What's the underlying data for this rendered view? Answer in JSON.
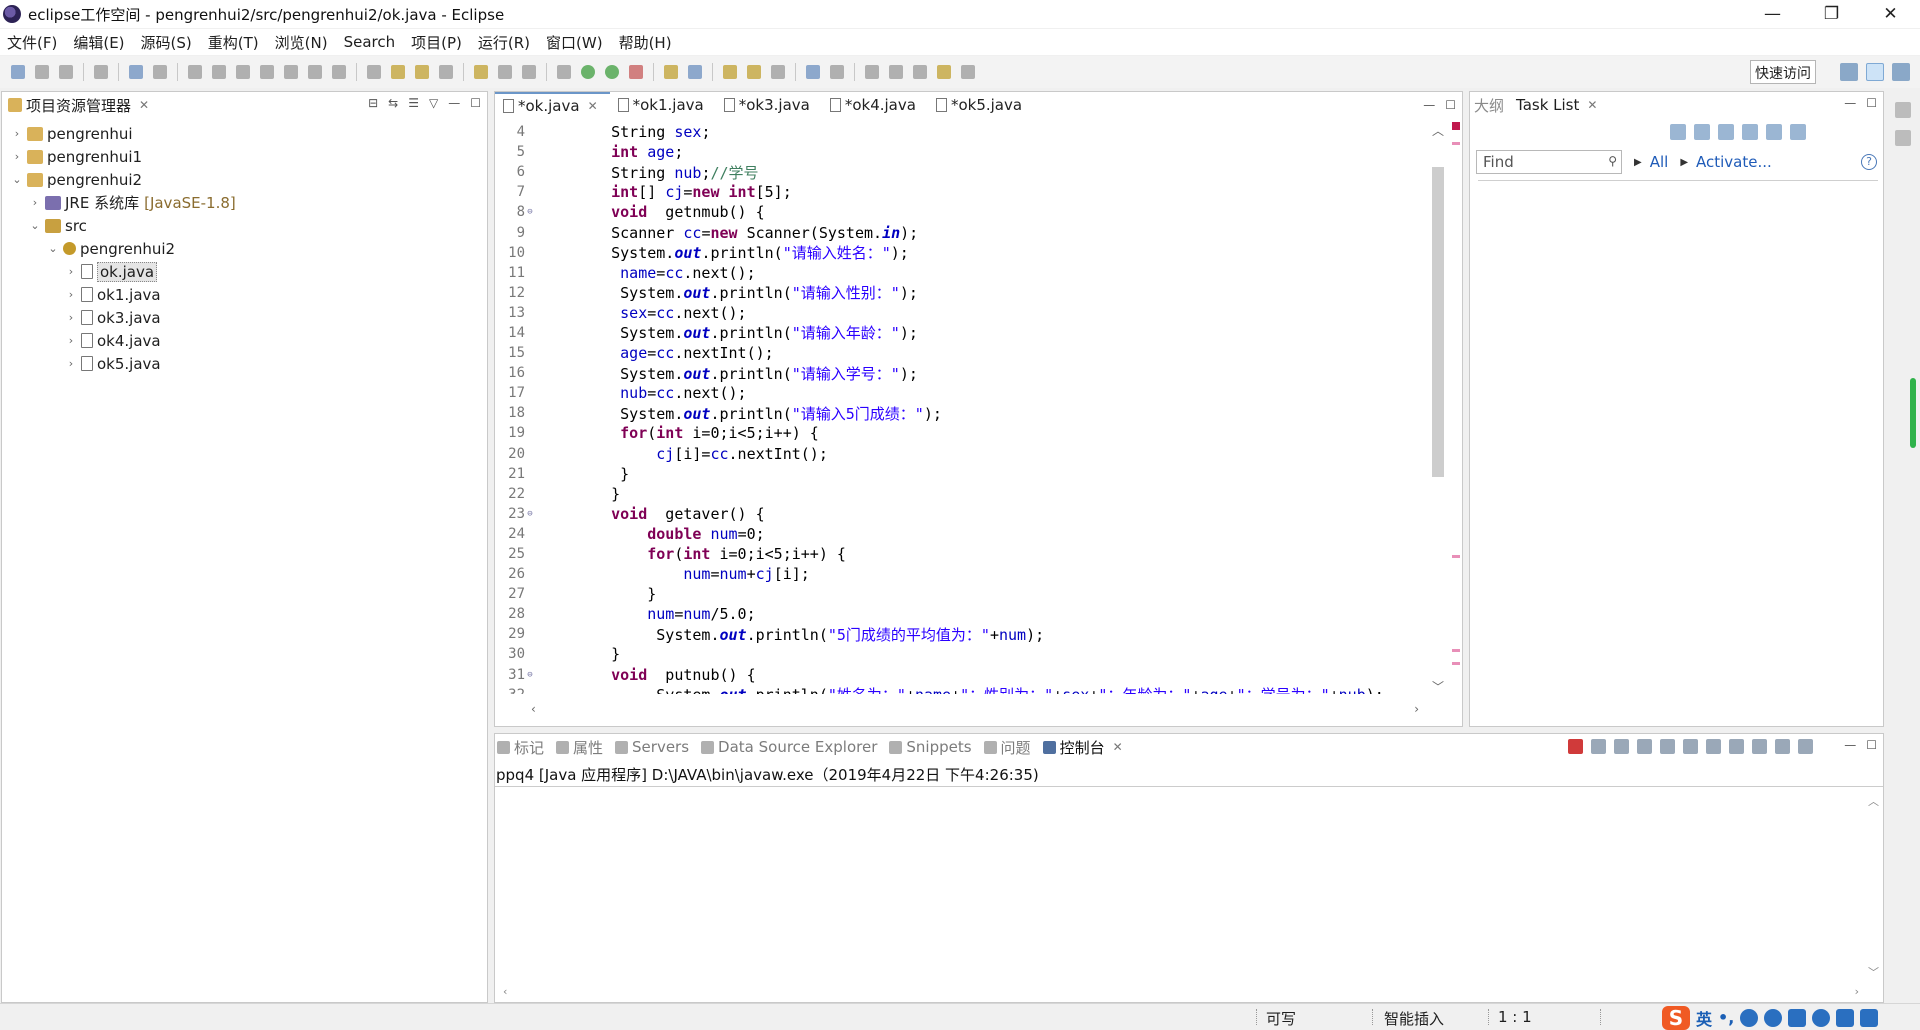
{
  "window": {
    "title": "eclipse工作空间 - pengrenhui2/src/pengrenhui2/ok.java - Eclipse"
  },
  "menu": [
    "文件(F)",
    "编辑(E)",
    "源码(S)",
    "重构(T)",
    "浏览(N)",
    "Search",
    "项目(P)",
    "运行(R)",
    "窗口(W)",
    "帮助(H)"
  ],
  "toolbar": {
    "quick_access": "快速访问"
  },
  "explorer": {
    "title": "项目资源管理器",
    "tree": [
      {
        "label": "pengrenhui",
        "twisty": "›",
        "icon": "project-icon",
        "indent": 0
      },
      {
        "label": "pengrenhui1",
        "twisty": "›",
        "icon": "project-icon",
        "indent": 0
      },
      {
        "label": "pengrenhui2",
        "twisty": "⌄",
        "icon": "project-icon",
        "indent": 0
      },
      {
        "label": "JRE 系统库",
        "extra": "[JavaSE-1.8]",
        "twisty": "›",
        "icon": "jre-library-icon",
        "indent": 1
      },
      {
        "label": "src",
        "twisty": "⌄",
        "icon": "source-folder-icon",
        "indent": 1
      },
      {
        "label": "pengrenhui2",
        "twisty": "⌄",
        "icon": "package-icon",
        "indent": 2
      },
      {
        "label": "ok.java",
        "twisty": "›",
        "icon": "java-file-icon",
        "indent": 3,
        "selected": true
      },
      {
        "label": "ok1.java",
        "twisty": "›",
        "icon": "java-file-icon",
        "indent": 3
      },
      {
        "label": "ok3.java",
        "twisty": "›",
        "icon": "java-file-icon",
        "indent": 3
      },
      {
        "label": "ok4.java",
        "twisty": "›",
        "icon": "java-file-icon",
        "indent": 3
      },
      {
        "label": "ok5.java",
        "twisty": "›",
        "icon": "java-file-icon",
        "indent": 3
      }
    ]
  },
  "editor": {
    "tabs": [
      {
        "label": "*ok.java",
        "active": true
      },
      {
        "label": "*ok1.java"
      },
      {
        "label": "*ok3.java"
      },
      {
        "label": "*ok4.java"
      },
      {
        "label": "*ok5.java"
      }
    ],
    "lines": [
      {
        "n": "4",
        "fold": "",
        "text": "    String sex;"
      },
      {
        "n": "5",
        "fold": "",
        "text": "    int age;"
      },
      {
        "n": "6",
        "fold": "",
        "text": "    String nub;//学号"
      },
      {
        "n": "7",
        "fold": "",
        "text": "    int[] cj=new int[5];"
      },
      {
        "n": "8",
        "fold": "⊖",
        "text": "    void  getnmub() {"
      },
      {
        "n": "9",
        "fold": "",
        "text": "    Scanner cc=new Scanner(System.in);"
      },
      {
        "n": "10",
        "fold": "",
        "text": "    System.out.println(\"请输入姓名：\");"
      },
      {
        "n": "11",
        "fold": "",
        "text": "     name=cc.next();"
      },
      {
        "n": "12",
        "fold": "",
        "text": "     System.out.println(\"请输入性别：\");"
      },
      {
        "n": "13",
        "fold": "",
        "text": "     sex=cc.next();"
      },
      {
        "n": "14",
        "fold": "",
        "text": "     System.out.println(\"请输入年龄：\");"
      },
      {
        "n": "15",
        "fold": "",
        "text": "     age=cc.nextInt();"
      },
      {
        "n": "16",
        "fold": "",
        "text": "     System.out.println(\"请输入学号：\");"
      },
      {
        "n": "17",
        "fold": "",
        "text": "     nub=cc.next();"
      },
      {
        "n": "18",
        "fold": "",
        "text": "     System.out.println(\"请输入5门成绩：\");"
      },
      {
        "n": "19",
        "fold": "",
        "text": "     for(int i=0;i<5;i++) {"
      },
      {
        "n": "20",
        "fold": "",
        "text": "         cj[i]=cc.nextInt();"
      },
      {
        "n": "21",
        "fold": "",
        "text": "     }"
      },
      {
        "n": "22",
        "fold": "",
        "text": "    }"
      },
      {
        "n": "23",
        "fold": "⊖",
        "text": "    void  getaver() {"
      },
      {
        "n": "24",
        "fold": "",
        "text": "        double num=0;"
      },
      {
        "n": "25",
        "fold": "",
        "text": "        for(int i=0;i<5;i++) {"
      },
      {
        "n": "26",
        "fold": "",
        "text": "            num=num+cj[i];"
      },
      {
        "n": "27",
        "fold": "",
        "text": "        }"
      },
      {
        "n": "28",
        "fold": "",
        "text": "        num=num/5.0;"
      },
      {
        "n": "29",
        "fold": "",
        "text": "         System.out.println(\"5门成绩的平均值为：\"+num);"
      },
      {
        "n": "30",
        "fold": "",
        "text": "    }"
      },
      {
        "n": "31",
        "fold": "⊖",
        "text": "    void  putnub() {"
      },
      {
        "n": "32",
        "fold": "",
        "text": "         System.out.println(\"姓名为：\"+name+\"；性别为：\"+sex+\"；年龄为：\"+age+\"；学号为：\"+nub);"
      }
    ]
  },
  "tasks": {
    "outline_tab": "大纲",
    "task_list_tab": "Task List",
    "find_placeholder": "Find",
    "all_link": "All",
    "activate_link": "Activate..."
  },
  "console": {
    "tabs": [
      {
        "label": "标记",
        "name": "tab-markers"
      },
      {
        "label": "属性",
        "name": "tab-properties"
      },
      {
        "label": "Servers",
        "name": "tab-servers"
      },
      {
        "label": "Data Source Explorer",
        "name": "tab-data-source-explorer"
      },
      {
        "label": "Snippets",
        "name": "tab-snippets"
      },
      {
        "label": "问题",
        "name": "tab-problems"
      },
      {
        "label": "控制台",
        "name": "tab-console",
        "active": true
      }
    ],
    "info": "ppq4 [Java 应用程序] D:\\JAVA\\bin\\javaw.exe（2019年4月22日 下午4:26:35)"
  },
  "status": {
    "writable": "可写",
    "insert_mode": "智能插入",
    "position": "1 : 1",
    "ime_logo": "S",
    "ime_lang": "英",
    "ime_punct": "•,"
  }
}
